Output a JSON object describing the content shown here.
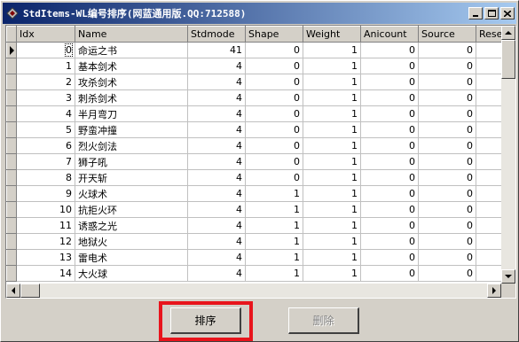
{
  "window": {
    "title": "StdItems-WL编号排序(网蓝通用版.QQ:712588)",
    "icon": "app-icon",
    "minimize_icon": "minimize-icon",
    "maximize_icon": "maximize-icon",
    "close_icon": "close-icon"
  },
  "grid": {
    "columns": [
      "Idx",
      "Name",
      "Stdmode",
      "Shape",
      "Weight",
      "Anicount",
      "Source",
      "Reser"
    ],
    "rows": [
      [
        "0",
        "命运之书",
        "41",
        "0",
        "1",
        "0",
        "0"
      ],
      [
        "1",
        "基本剑术",
        "4",
        "0",
        "1",
        "0",
        "0"
      ],
      [
        "2",
        "攻杀剑术",
        "4",
        "0",
        "1",
        "0",
        "0"
      ],
      [
        "3",
        "刺杀剑术",
        "4",
        "0",
        "1",
        "0",
        "0"
      ],
      [
        "4",
        "半月弯刀",
        "4",
        "0",
        "1",
        "0",
        "0"
      ],
      [
        "5",
        "野蛮冲撞",
        "4",
        "0",
        "1",
        "0",
        "0"
      ],
      [
        "6",
        "烈火剑法",
        "4",
        "0",
        "1",
        "0",
        "0"
      ],
      [
        "7",
        "狮子吼",
        "4",
        "0",
        "1",
        "0",
        "0"
      ],
      [
        "8",
        "开天斩",
        "4",
        "0",
        "1",
        "0",
        "0"
      ],
      [
        "9",
        "火球术",
        "4",
        "1",
        "1",
        "0",
        "0"
      ],
      [
        "10",
        "抗拒火环",
        "4",
        "1",
        "1",
        "0",
        "0"
      ],
      [
        "11",
        "诱惑之光",
        "4",
        "1",
        "1",
        "0",
        "0"
      ],
      [
        "12",
        "地狱火",
        "4",
        "1",
        "1",
        "0",
        "0"
      ],
      [
        "13",
        "雷电术",
        "4",
        "1",
        "1",
        "0",
        "0"
      ],
      [
        "14",
        "大火球",
        "4",
        "1",
        "1",
        "0",
        "0"
      ]
    ],
    "current_row_indicator": "row-pointer-icon"
  },
  "buttons": {
    "sort_label": "排序",
    "delete_label": "删除"
  },
  "colors": {
    "title_start": "#0a246a",
    "title_end": "#a6caf0",
    "face": "#d4d0c8",
    "highlight_box": "#e8141c"
  }
}
